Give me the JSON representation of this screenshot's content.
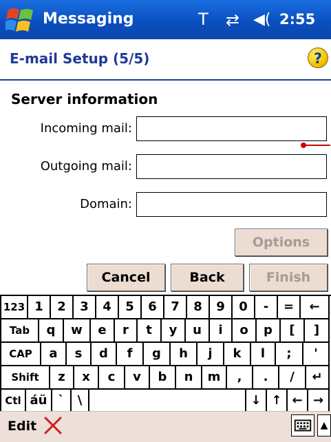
{
  "titlebar": {
    "app_title": "Messaging",
    "time": "2:55",
    "icons": [
      "windows-start-icon",
      "signal-antenna-icon",
      "sync-arrows-icon",
      "speaker-icon"
    ]
  },
  "header": {
    "title": "E-mail Setup (5/5)",
    "help_icon": "?"
  },
  "form": {
    "section_title": "Server information",
    "incoming": {
      "label": "Incoming mail:",
      "value": ""
    },
    "outgoing": {
      "label": "Outgoing mail:",
      "value": ""
    },
    "domain": {
      "label": "Domain:",
      "value": ""
    },
    "options_label": "Options"
  },
  "buttons": {
    "cancel": "Cancel",
    "back": "Back",
    "finish": "Finish"
  },
  "keyboard": {
    "row1": [
      "123",
      "1",
      "2",
      "3",
      "4",
      "5",
      "6",
      "7",
      "8",
      "9",
      "0",
      "-",
      "=",
      "←"
    ],
    "row2": [
      "Tab",
      "q",
      "w",
      "e",
      "r",
      "t",
      "y",
      "u",
      "i",
      "o",
      "p",
      "[",
      "]"
    ],
    "row3": [
      "CAP",
      "a",
      "s",
      "d",
      "f",
      "g",
      "h",
      "j",
      "k",
      "l",
      ";",
      "'"
    ],
    "row4": [
      "Shift",
      "z",
      "x",
      "c",
      "v",
      "b",
      "n",
      "m",
      ",",
      ".",
      "/",
      "↵"
    ],
    "row5": [
      "Ctl",
      "áü",
      "`",
      "\\",
      "",
      "↓",
      "↑",
      "←",
      "→"
    ]
  },
  "bottombar": {
    "edit_label": "Edit",
    "arrow": "▲"
  },
  "colors": {
    "titlebar": "#0a4fbf",
    "header_text": "#1e3a98",
    "button_bg": "#ecdcd2",
    "bottombar_bg": "#ece0d8"
  }
}
